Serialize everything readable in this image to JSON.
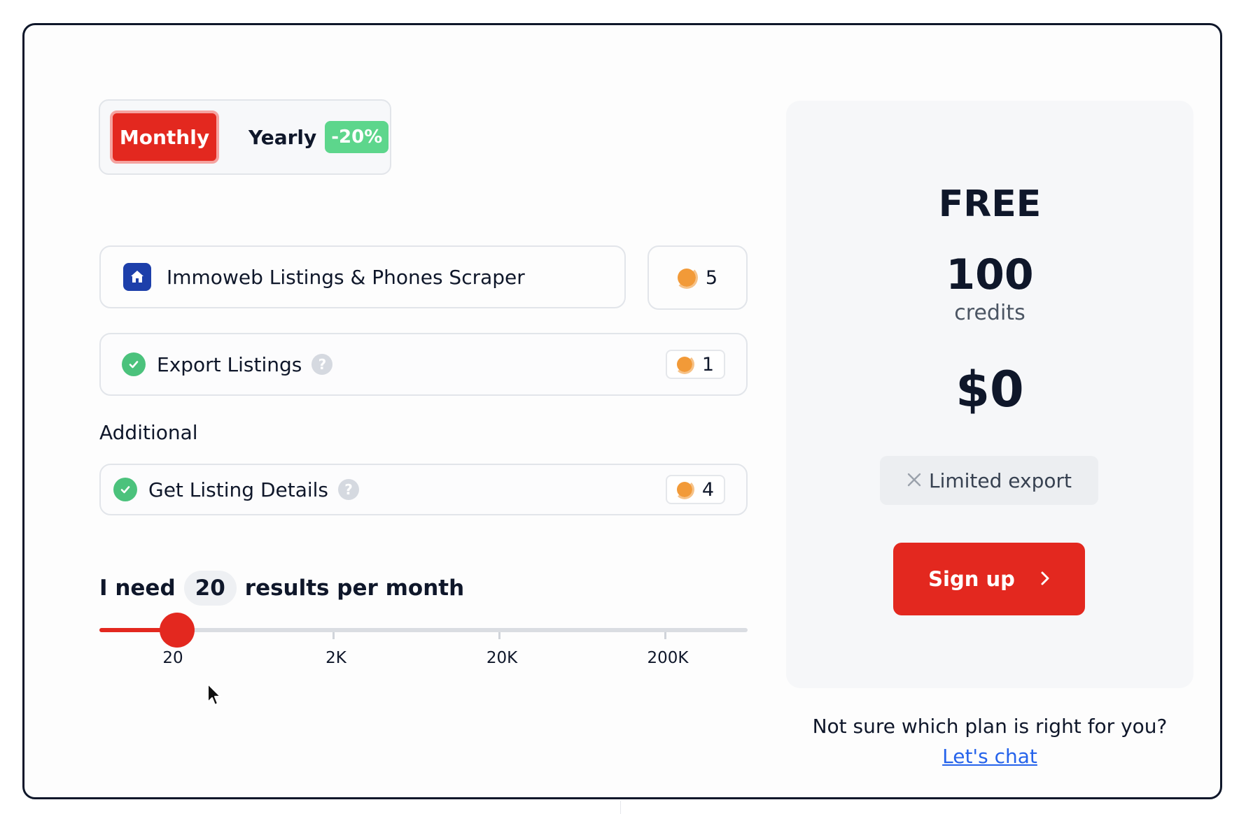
{
  "billing": {
    "monthly_label": "Monthly",
    "yearly_label": "Yearly",
    "yearly_discount": "-20%",
    "selected": "monthly"
  },
  "actor": {
    "name": "Immoweb Listings & Phones Scraper",
    "cost": "5"
  },
  "options": [
    {
      "label": "Export Listings",
      "cost": "1",
      "checked": true
    },
    {
      "label": "Get Listing Details",
      "cost": "4",
      "checked": true
    }
  ],
  "additional_label": "Additional",
  "results": {
    "prefix": "I need",
    "count": "20",
    "suffix": "results per month",
    "ticks": [
      "20",
      "2K",
      "20K",
      "200K"
    ],
    "fill_fraction": 0.12
  },
  "plan": {
    "name": "FREE",
    "credits": "100",
    "credits_label": "credits",
    "price": "$0",
    "limitation": "Limited export",
    "cta_label": "Sign up"
  },
  "help": {
    "question": "Not sure which plan is right for you?",
    "link_label": "Let's chat"
  },
  "colors": {
    "accent": "#e3281f",
    "discount": "#5dd68c",
    "check": "#4bc27c",
    "coin": "#f29a38",
    "link": "#2563eb"
  }
}
